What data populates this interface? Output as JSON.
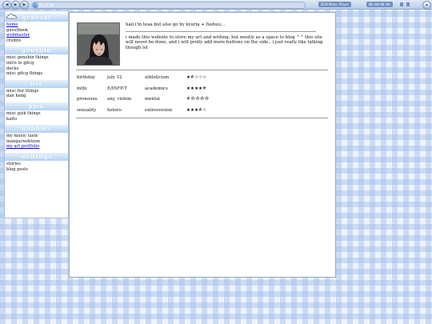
{
  "player": {
    "track_time": "7:00 / 5:38",
    "name": "SCM Music Player",
    "time": "00:00/00:00",
    "progress_fraction": 0.02
  },
  "sidebar": {
    "sections": [
      {
        "title": "general",
        "items": [
          {
            "label": "home",
            "link": true
          },
          {
            "label": "guestbook",
            "link": false
          },
          {
            "label": "webmaster",
            "link": true
          },
          {
            "label": "credits",
            "link": false
          }
        ]
      },
      {
        "title": "genshin",
        "items": [
          {
            "label": "misc genshin things",
            "link": false
          },
          {
            "label": "intro to gitcg",
            "link": false
          },
          {
            "label": "decks",
            "link": false
          },
          {
            "label": "misc gitcg things",
            "link": false
          }
        ]
      },
      {
        "title": "hsr",
        "items": [
          {
            "label": "misc hsr things",
            "link": false
          },
          {
            "label": "dan heng",
            "link": false
          }
        ]
      },
      {
        "title": "pjsk",
        "items": [
          {
            "label": "misc pjsk things",
            "link": false
          },
          {
            "label": "kaito",
            "link": false
          }
        ]
      },
      {
        "title": "hobbies",
        "items": [
          {
            "label": "my music taste",
            "link": false
          },
          {
            "label": "manga/webtoon",
            "link": false
          },
          {
            "label": "my art portfolio",
            "link": true
          }
        ]
      },
      {
        "title": "writings",
        "items": [
          {
            "label": "stories",
            "link": false
          },
          {
            "label": "blog posts",
            "link": false
          }
        ]
      }
    ]
  },
  "intro": {
    "greeting": "haii i'm teaa but also go by kyaria + fushuu...",
    "body": "i made this website to store my art and writing, but mostly as a space to blog ^^ this site will never be done, and i will prolly add more buttons on the side.. i just really like talking though lol"
  },
  "stats": [
    {
      "label": "birthday",
      "value": "july 12",
      "trait": "athleticism",
      "rating": "★⯪☆☆☆"
    },
    {
      "label": "mtbi",
      "value": "E/INFP-T",
      "trait": "academics",
      "rating": "★★★★⯪"
    },
    {
      "label": "pronouns",
      "value": "any, cisfem",
      "trait": "mental",
      "rating": "⯪☆☆☆☆"
    },
    {
      "label": "sexuality",
      "value": "hetero",
      "trait": "extroversion",
      "rating": "★★★⯪☆"
    }
  ]
}
